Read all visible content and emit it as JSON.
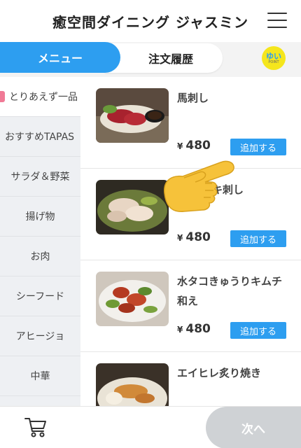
{
  "header": {
    "title": "癒空間ダイニング ジャスミン"
  },
  "tabs": {
    "menu": "メニュー",
    "history": "注文履歴"
  },
  "logo": {
    "line1": "ゆい",
    "line2": "POINT"
  },
  "sidebar": {
    "items": [
      {
        "label": "とりあえず一品",
        "active": true
      },
      {
        "label": "おすすめTAPAS"
      },
      {
        "label": "サラダ＆野菜"
      },
      {
        "label": "揚げ物"
      },
      {
        "label": "お肉"
      },
      {
        "label": "シーフード"
      },
      {
        "label": "アヒージョ"
      },
      {
        "label": "中華"
      }
    ]
  },
  "menu_items": [
    {
      "name": "馬刺し",
      "yen": "¥",
      "price": "480",
      "add_label": "追加する"
    },
    {
      "name": "タタキ刺し",
      "yen": "¥",
      "price": "480",
      "add_label": "追加する"
    },
    {
      "name": "水タコきゅうりキムチ和え",
      "yen": "¥",
      "price": "480",
      "add_label": "追加する"
    },
    {
      "name": "エイヒレ炙り焼き"
    }
  ],
  "bottom": {
    "next_label": "次へ"
  },
  "colors": {
    "accent": "#2d9ef0",
    "active_marker": "#f07a96",
    "disabled": "#cfd2d5"
  }
}
